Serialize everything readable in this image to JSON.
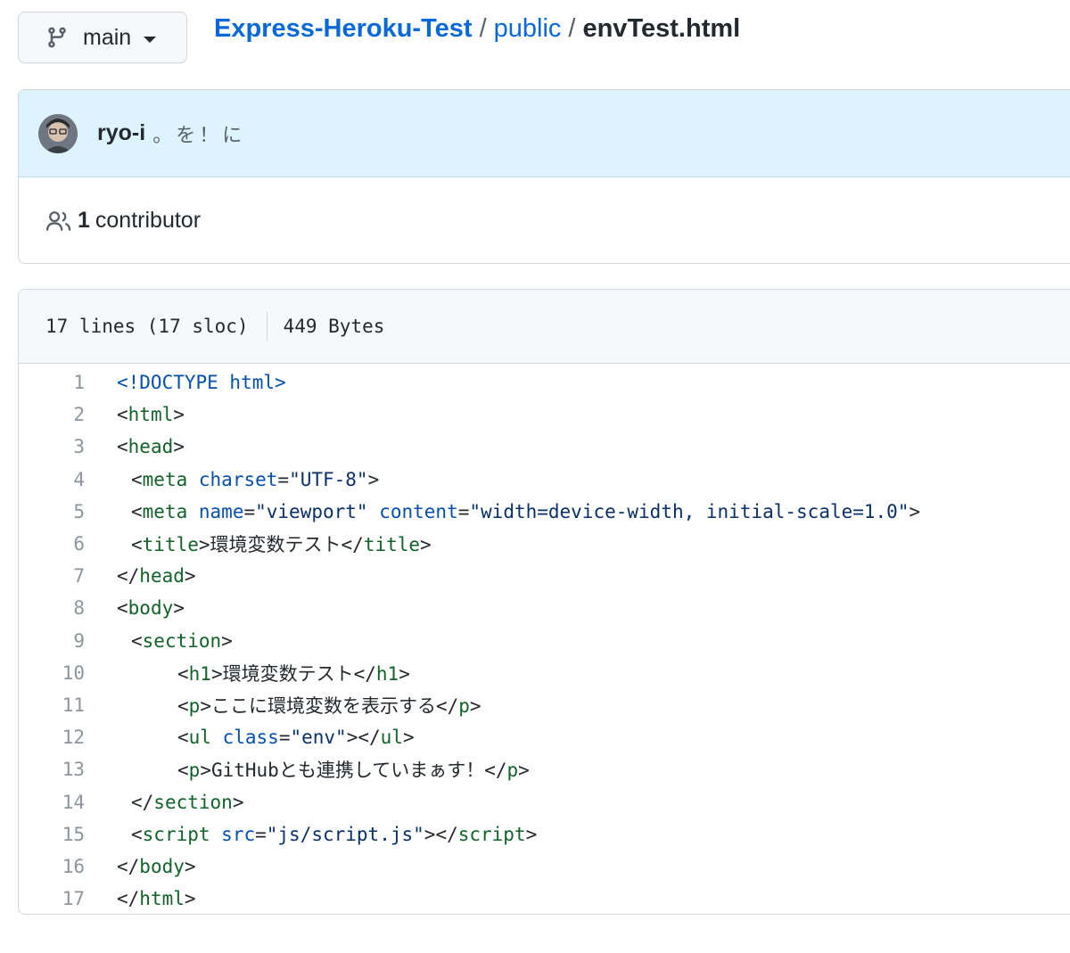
{
  "branch": {
    "name": "main",
    "icon": "git-branch-icon"
  },
  "breadcrumb": {
    "repo": "Express-Heroku-Test",
    "sep1": "/",
    "dir": "public",
    "sep2": "/",
    "file": "envTest.html"
  },
  "commit": {
    "author": "ryo-i",
    "message": "。を！に",
    "avatar_icon": "avatar"
  },
  "contributors": {
    "icon": "people-icon",
    "count": "1",
    "label": "contributor"
  },
  "file_info": {
    "lines": "17 lines (17 sloc)",
    "size": "449 Bytes"
  },
  "code": {
    "line_numbers": [
      "1",
      "2",
      "3",
      "4",
      "5",
      "6",
      "7",
      "8",
      "9",
      "10",
      "11",
      "12",
      "13",
      "14",
      "15",
      "16",
      "17"
    ],
    "l1": {
      "doctype": "<!DOCTYPE html>"
    },
    "l2": {
      "open": "<",
      "tag": "html",
      "close": ">"
    },
    "l3": {
      "open": "<",
      "tag": "head",
      "close": ">"
    },
    "l4": {
      "open": "<",
      "tag": "meta",
      "attr": "charset",
      "eq": "=",
      "val": "\"UTF-8\"",
      "close": ">"
    },
    "l5": {
      "open": "<",
      "tag": "meta",
      "attr1": "name",
      "eq1": "=",
      "val1": "\"viewport\"",
      "attr2": "content",
      "eq2": "=",
      "val2": "\"width=device-width, initial-scale=1.0\"",
      "close": ">"
    },
    "l6": {
      "open": "<",
      "tag": "title",
      "close": ">",
      "text": "環境変数テスト",
      "end_open": "</",
      "end_tag": "title",
      "end_close": ">"
    },
    "l7": {
      "open": "</",
      "tag": "head",
      "close": ">"
    },
    "l8": {
      "open": "<",
      "tag": "body",
      "close": ">"
    },
    "l9": {
      "open": "<",
      "tag": "section",
      "close": ">"
    },
    "l10": {
      "open": "<",
      "tag": "h1",
      "close": ">",
      "text": "環境変数テスト",
      "end_open": "</",
      "end_tag": "h1",
      "end_close": ">"
    },
    "l11": {
      "open": "<",
      "tag": "p",
      "close": ">",
      "text": "ここに環境変数を表示する",
      "end_open": "</",
      "end_tag": "p",
      "end_close": ">"
    },
    "l12": {
      "open": "<",
      "tag": "ul",
      "attr": "class",
      "eq": "=",
      "val": "\"env\"",
      "close": ">",
      "end_open": "</",
      "end_tag": "ul",
      "end_close": ">"
    },
    "l13": {
      "open": "<",
      "tag": "p",
      "close": ">",
      "text": "GitHubとも連携していまぁす！",
      "end_open": "</",
      "end_tag": "p",
      "end_close": ">"
    },
    "l14": {
      "open": "</",
      "tag": "section",
      "close": ">"
    },
    "l15": {
      "open": "<",
      "tag": "script",
      "attr": "src",
      "eq": "=",
      "val": "\"js/script.js\"",
      "close": ">",
      "end_open": "</",
      "end_tag": "script",
      "end_close": ">"
    },
    "l16": {
      "open": "</",
      "tag": "body",
      "close": ">"
    },
    "l17": {
      "open": "</",
      "tag": "html",
      "close": ">"
    }
  },
  "colors": {
    "link": "#0969da",
    "tag": "#116329",
    "attr": "#0550ae",
    "string": "#0a3069",
    "commit_bg": "#ddf4ff"
  }
}
